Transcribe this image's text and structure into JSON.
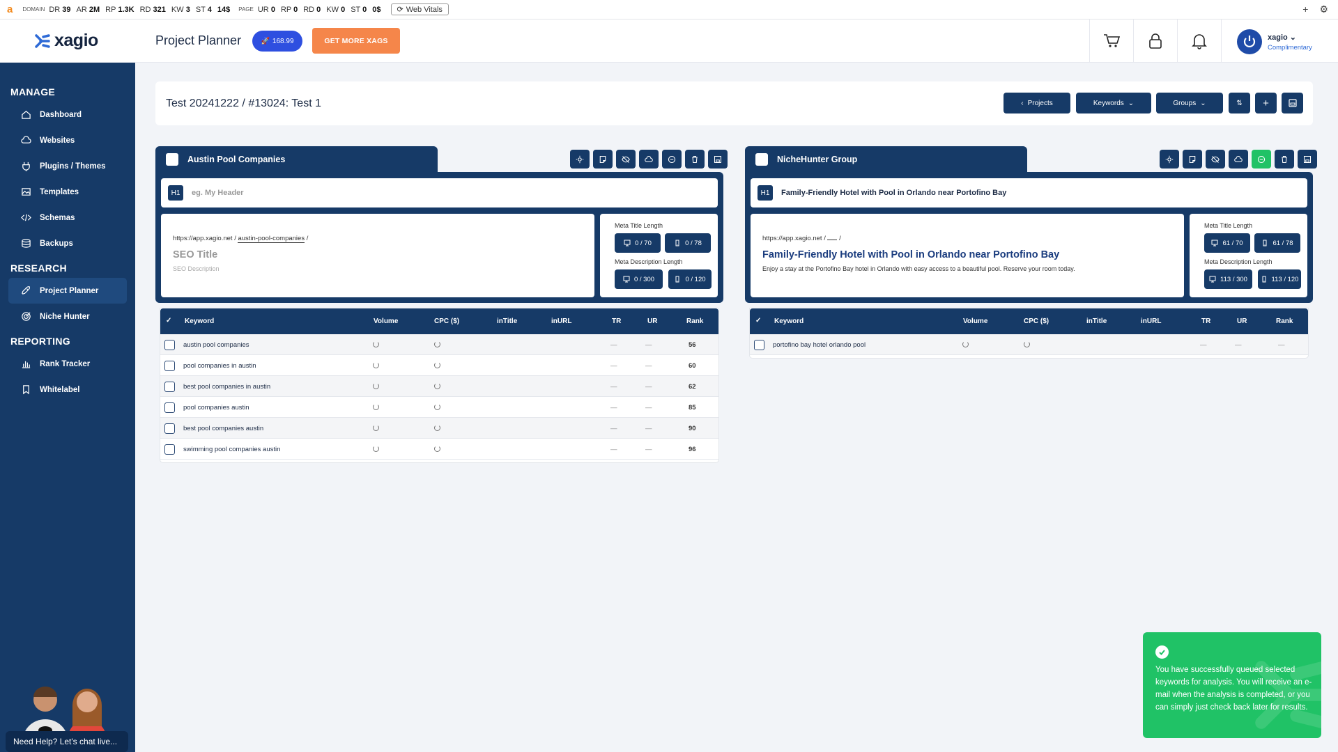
{
  "seo_bar": {
    "domain_label": "DOMAIN",
    "page_label": "PAGE",
    "domain_metrics": [
      {
        "k": "DR",
        "v": "39"
      },
      {
        "k": "AR",
        "v": "2M"
      },
      {
        "k": "RP",
        "v": "1.3K"
      },
      {
        "k": "RD",
        "v": "321"
      },
      {
        "k": "KW",
        "v": "3"
      },
      {
        "k": "ST",
        "v": "4"
      },
      {
        "k": "",
        "v": "14$"
      }
    ],
    "page_metrics": [
      {
        "k": "UR",
        "v": "0"
      },
      {
        "k": "RP",
        "v": "0"
      },
      {
        "k": "RD",
        "v": "0"
      },
      {
        "k": "KW",
        "v": "0"
      },
      {
        "k": "ST",
        "v": "0"
      },
      {
        "k": "",
        "v": "0$"
      }
    ],
    "web_vitals": "Web Vitals"
  },
  "header": {
    "brand": "xagio",
    "page_title": "Project Planner",
    "xags_balance": "168.99",
    "get_more": "GET MORE XAGS",
    "user_name": "xagio",
    "user_plan": "Complimentary"
  },
  "sidebar": {
    "sections": [
      {
        "title": "MANAGE",
        "items": [
          {
            "label": "Dashboard",
            "icon": "home-icon"
          },
          {
            "label": "Websites",
            "icon": "cloud-icon"
          },
          {
            "label": "Plugins / Themes",
            "icon": "plug-icon"
          },
          {
            "label": "Templates",
            "icon": "image-icon"
          },
          {
            "label": "Schemas",
            "icon": "code-icon"
          },
          {
            "label": "Backups",
            "icon": "database-icon"
          }
        ]
      },
      {
        "title": "RESEARCH",
        "items": [
          {
            "label": "Project Planner",
            "icon": "rocket-icon",
            "active": true
          },
          {
            "label": "Niche Hunter",
            "icon": "target-icon"
          }
        ]
      },
      {
        "title": "REPORTING",
        "items": [
          {
            "label": "Rank Tracker",
            "icon": "bar-chart-icon"
          },
          {
            "label": "Whitelabel",
            "icon": "bookmark-icon"
          }
        ]
      }
    ],
    "chat": "Need Help? Let's chat live..."
  },
  "project": {
    "breadcrumb": "Test 20241222 / #13024: Test 1",
    "buttons": {
      "projects": "Projects",
      "keywords": "Keywords",
      "groups": "Groups"
    }
  },
  "table_headers": [
    "Keyword",
    "Volume",
    "CPC ($)",
    "inTitle",
    "inURL",
    "TR",
    "UR",
    "Rank"
  ],
  "groups": [
    {
      "name": "Austin Pool Companies",
      "h1": "",
      "h1_placeholder": "eg. My Header",
      "h1_tag": "H1",
      "url_base": "https://app.xagio.net /",
      "url_slug": "austin-pool-companies",
      "url_end": "/",
      "seo_title": "SEO Title",
      "seo_desc": "SEO Description",
      "meta_title_label": "Meta Title Length",
      "meta_title_desktop": "0 / 70",
      "meta_title_mobile": "0 / 78",
      "meta_desc_label": "Meta Description Length",
      "meta_desc_desktop": "0 / 300",
      "meta_desc_mobile": "0 / 120",
      "keywords": [
        {
          "kw": "austin pool companies",
          "tr": "—",
          "ur": "—",
          "rank": "56"
        },
        {
          "kw": "pool companies in austin",
          "tr": "—",
          "ur": "—",
          "rank": "60"
        },
        {
          "kw": "best pool companies in austin",
          "tr": "—",
          "ur": "—",
          "rank": "62"
        },
        {
          "kw": "pool companies austin",
          "tr": "—",
          "ur": "—",
          "rank": "85"
        },
        {
          "kw": "best pool companies austin",
          "tr": "—",
          "ur": "—",
          "rank": "90"
        },
        {
          "kw": "swimming pool companies austin",
          "tr": "—",
          "ur": "—",
          "rank": "96"
        }
      ]
    },
    {
      "name": "NicheHunter Group",
      "h1": "Family-Friendly Hotel with Pool in Orlando near Portofino Bay",
      "h1_tag": "H1",
      "url_base": "https://app.xagio.net /",
      "url_slug": "",
      "url_end": "/",
      "seo_title": "Family-Friendly Hotel with Pool in Orlando near Portofino Bay",
      "seo_desc": "Enjoy a stay at the Portofino Bay hotel in Orlando with easy access to a beautiful pool. Reserve your room today.",
      "meta_title_label": "Meta Title Length",
      "meta_title_desktop": "61 / 70",
      "meta_title_mobile": "61 / 78",
      "meta_desc_label": "Meta Description Length",
      "meta_desc_desktop": "113 / 300",
      "meta_desc_mobile": "113 / 120",
      "keywords": [
        {
          "kw": "portofino bay hotel orlando pool",
          "tr": "—",
          "ur": "—",
          "rank": "—"
        }
      ]
    }
  ],
  "toast": {
    "message": "You have successfully queued selected keywords for analysis. You will receive an e-mail when the analysis is completed, or you can simply just check back later for results."
  },
  "colors": {
    "navy": "#163a67",
    "accent_orange": "#f5864a",
    "xags_blue": "#2e4fe0",
    "success": "#20c266"
  }
}
